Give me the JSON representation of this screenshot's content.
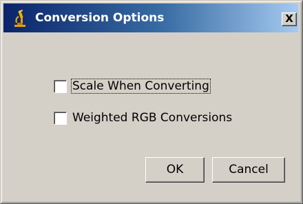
{
  "dialog": {
    "title": "Conversion Options",
    "icon": "microscope-icon",
    "close_glyph": "X"
  },
  "options": [
    {
      "label": "Scale When Converting",
      "checked": false,
      "focused": true
    },
    {
      "label": "Weighted RGB Conversions",
      "checked": false,
      "focused": false
    }
  ],
  "buttons": {
    "ok_label": "OK",
    "cancel_label": "Cancel"
  },
  "colors": {
    "title_bar_start": "#0a246a",
    "title_bar_end": "#a6caf0",
    "dialog_face": "#d4d0c8"
  }
}
